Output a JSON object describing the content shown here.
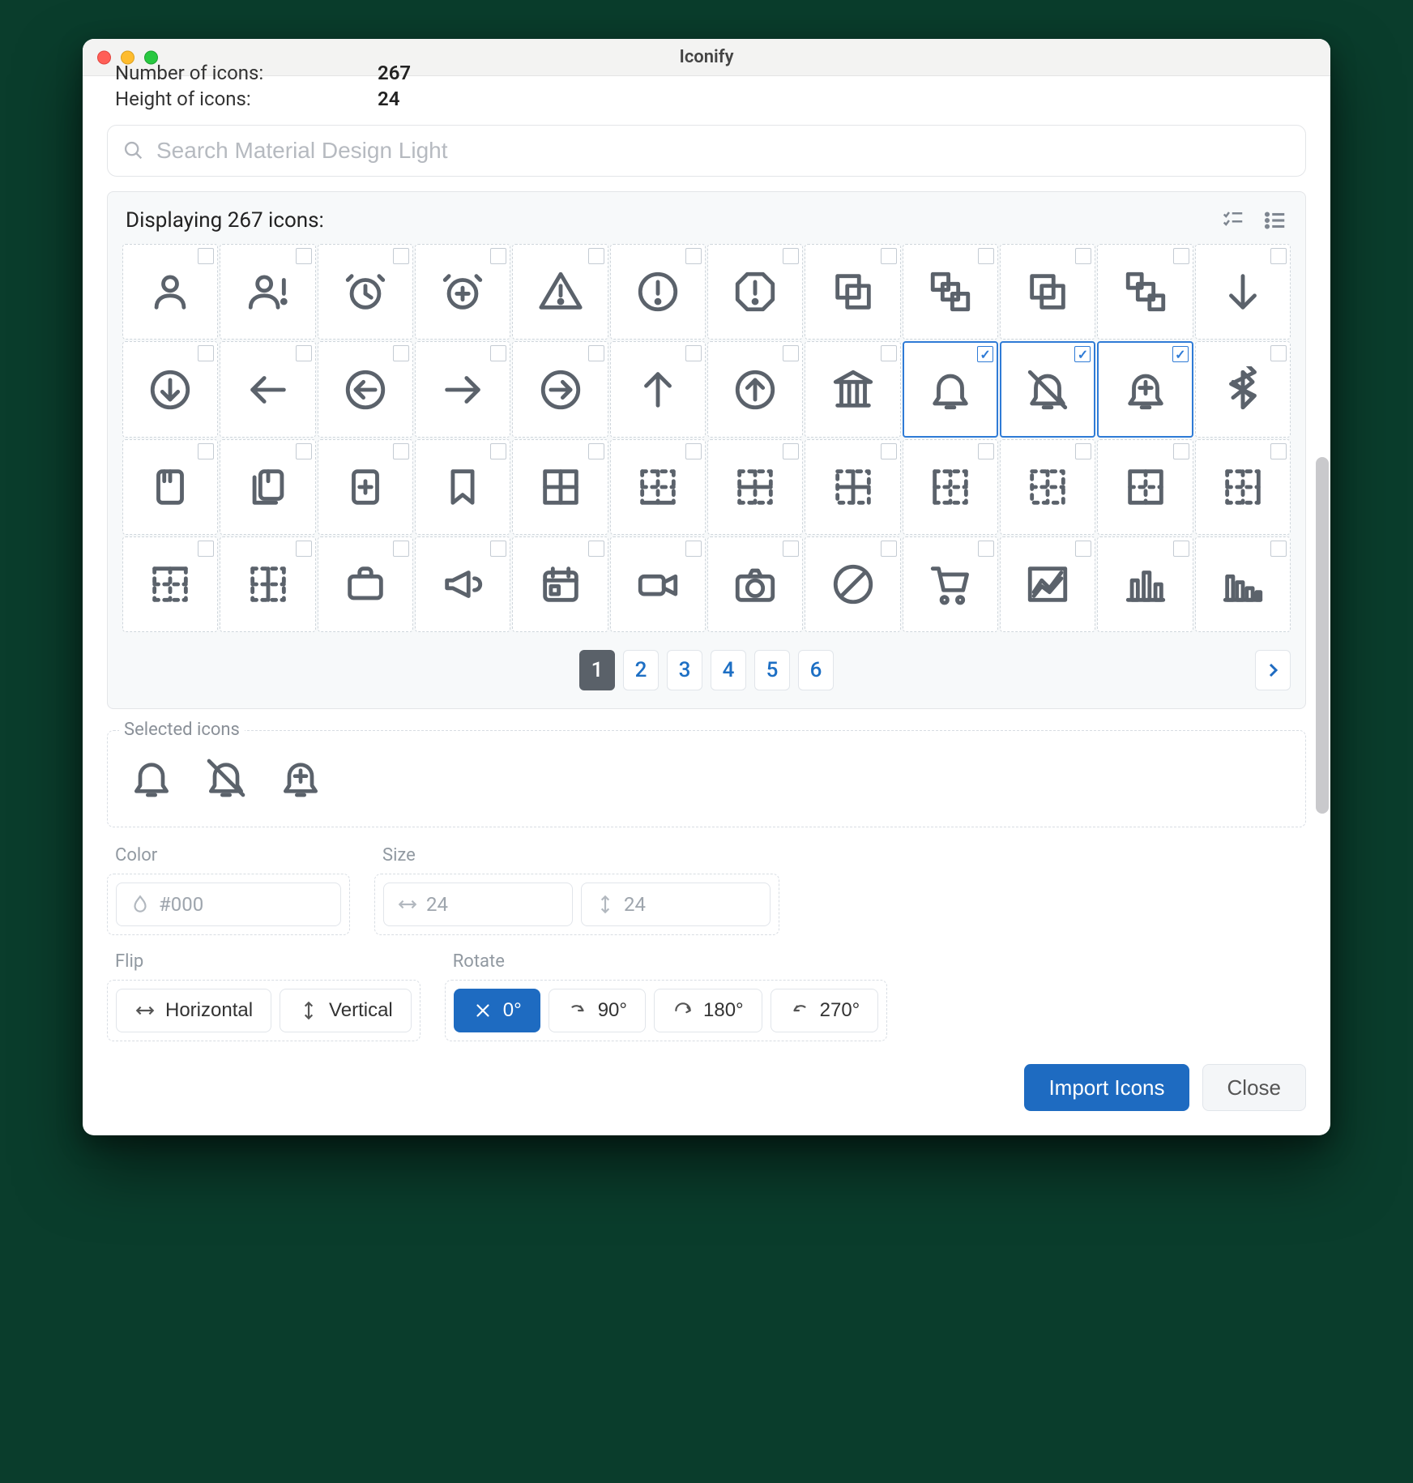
{
  "window": {
    "title": "Iconify"
  },
  "meta": {
    "number_icons_label": "Number of icons:",
    "number_icons_value": "267",
    "height_icons_label": "Height of icons:",
    "height_icons_value": "24"
  },
  "search": {
    "placeholder": "Search Material Design Light"
  },
  "panel": {
    "displaying_prefix": "Displaying",
    "displaying_count": "267",
    "displaying_suffix": "icons:"
  },
  "grid": {
    "icons": [
      {
        "name": "account",
        "selected": false
      },
      {
        "name": "account-alert",
        "selected": false
      },
      {
        "name": "alarm",
        "selected": false
      },
      {
        "name": "alarm-plus",
        "selected": false
      },
      {
        "name": "alert",
        "selected": false
      },
      {
        "name": "alert-circle",
        "selected": false
      },
      {
        "name": "alert-octagon",
        "selected": false
      },
      {
        "name": "arrange-bring-forward",
        "selected": false
      },
      {
        "name": "arrange-bring-to-front",
        "selected": false
      },
      {
        "name": "arrange-send-backward",
        "selected": false
      },
      {
        "name": "arrange-send-to-back",
        "selected": false
      },
      {
        "name": "arrow-down",
        "selected": false
      },
      {
        "name": "arrow-down-circle",
        "selected": false
      },
      {
        "name": "arrow-left",
        "selected": false
      },
      {
        "name": "arrow-left-circle",
        "selected": false
      },
      {
        "name": "arrow-right",
        "selected": false
      },
      {
        "name": "arrow-right-circle",
        "selected": false
      },
      {
        "name": "arrow-up",
        "selected": false
      },
      {
        "name": "arrow-up-circle",
        "selected": false
      },
      {
        "name": "bank",
        "selected": false
      },
      {
        "name": "bell",
        "selected": true
      },
      {
        "name": "bell-off",
        "selected": true
      },
      {
        "name": "bell-plus",
        "selected": true
      },
      {
        "name": "bluetooth",
        "selected": false
      },
      {
        "name": "book",
        "selected": false
      },
      {
        "name": "book-multiple",
        "selected": false
      },
      {
        "name": "book-plus",
        "selected": false
      },
      {
        "name": "bookmark",
        "selected": false
      },
      {
        "name": "border-all",
        "selected": false
      },
      {
        "name": "border-bottom",
        "selected": false
      },
      {
        "name": "border-horizontal",
        "selected": false
      },
      {
        "name": "border-inside",
        "selected": false
      },
      {
        "name": "border-left",
        "selected": false
      },
      {
        "name": "border-none",
        "selected": false
      },
      {
        "name": "border-outside",
        "selected": false
      },
      {
        "name": "border-right",
        "selected": false
      },
      {
        "name": "border-top",
        "selected": false
      },
      {
        "name": "border-vertical",
        "selected": false
      },
      {
        "name": "briefcase",
        "selected": false
      },
      {
        "name": "bullhorn",
        "selected": false
      },
      {
        "name": "calendar",
        "selected": false
      },
      {
        "name": "camcorder",
        "selected": false
      },
      {
        "name": "camera",
        "selected": false
      },
      {
        "name": "cancel",
        "selected": false
      },
      {
        "name": "cart",
        "selected": false
      },
      {
        "name": "chart-areaspline",
        "selected": false
      },
      {
        "name": "chart-bar",
        "selected": false
      },
      {
        "name": "chart-histogram",
        "selected": false
      }
    ]
  },
  "pagination": {
    "pages": [
      "1",
      "2",
      "3",
      "4",
      "5",
      "6"
    ],
    "active": "1"
  },
  "selected_section": {
    "legend": "Selected icons",
    "icons": [
      "bell",
      "bell-off",
      "bell-plus"
    ]
  },
  "color": {
    "label": "Color",
    "placeholder": "#000"
  },
  "size": {
    "label": "Size",
    "width_placeholder": "24",
    "height_placeholder": "24"
  },
  "flip": {
    "label": "Flip",
    "horizontal": "Horizontal",
    "vertical": "Vertical"
  },
  "rotate": {
    "label": "Rotate",
    "options": [
      {
        "label": "0°",
        "active": true
      },
      {
        "label": "90°",
        "active": false
      },
      {
        "label": "180°",
        "active": false
      },
      {
        "label": "270°",
        "active": false
      }
    ]
  },
  "footer": {
    "import_btn": "Import Icons",
    "close_btn": "Close"
  }
}
